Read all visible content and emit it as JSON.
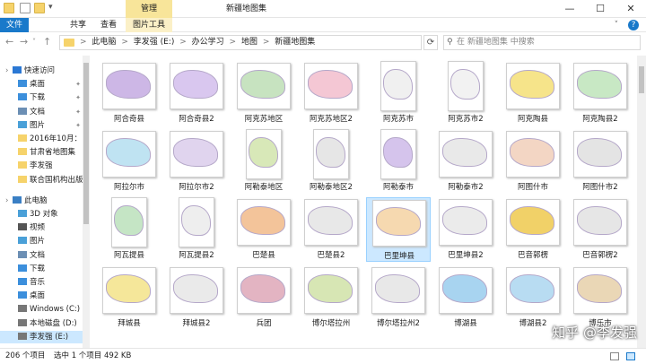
{
  "window": {
    "title": "新疆地图集",
    "context_tab": "管理",
    "controls": {
      "minimize": "—",
      "maximize": "☐",
      "close": "✕"
    }
  },
  "ribbon": {
    "tabs": [
      "文件",
      "共享",
      "查看",
      "图片工具"
    ],
    "chevron": "˅",
    "help": "?"
  },
  "address": {
    "crumbs": [
      "此电脑",
      "李发强 (E:)",
      "办公学习",
      "地图",
      "新疆地图集"
    ],
    "separator": ">",
    "search_placeholder": "在 新疆地图集 中搜索"
  },
  "sidebar": {
    "items": [
      {
        "label": "快速访问",
        "icon": "star-icon",
        "color": "#2b78d4",
        "level": 0,
        "pin": false
      },
      {
        "label": "桌面",
        "icon": "desktop-icon",
        "color": "#3c8fdc",
        "level": 1,
        "pin": true
      },
      {
        "label": "下载",
        "icon": "download-icon",
        "color": "#3c8fdc",
        "level": 1,
        "pin": true
      },
      {
        "label": "文档",
        "icon": "document-icon",
        "color": "#6c8fb4",
        "level": 1,
        "pin": true
      },
      {
        "label": "图片",
        "icon": "picture-icon",
        "color": "#4aa0d8",
        "level": 1,
        "pin": true
      },
      {
        "label": "2016年10月：",
        "icon": "folder-icon",
        "color": "#f6d36b",
        "level": 1,
        "pin": false
      },
      {
        "label": "甘肃省地图集",
        "icon": "folder-icon",
        "color": "#f6d36b",
        "level": 1,
        "pin": false
      },
      {
        "label": "李发强",
        "icon": "folder-icon",
        "color": "#f6d36b",
        "level": 1,
        "pin": false
      },
      {
        "label": "联合国机构出版",
        "icon": "folder-icon",
        "color": "#f6d36b",
        "level": 1,
        "pin": false
      },
      {
        "label": "此电脑",
        "icon": "computer-icon",
        "color": "#3a7fc4",
        "level": 0,
        "pin": false
      },
      {
        "label": "3D 对象",
        "icon": "cube-icon",
        "color": "#4aa0d8",
        "level": 1,
        "pin": false
      },
      {
        "label": "视频",
        "icon": "video-icon",
        "color": "#555",
        "level": 1,
        "pin": false
      },
      {
        "label": "图片",
        "icon": "picture-icon",
        "color": "#4aa0d8",
        "level": 1,
        "pin": false
      },
      {
        "label": "文档",
        "icon": "document-icon",
        "color": "#6c8fb4",
        "level": 1,
        "pin": false
      },
      {
        "label": "下载",
        "icon": "download-icon",
        "color": "#3c8fdc",
        "level": 1,
        "pin": false
      },
      {
        "label": "音乐",
        "icon": "music-icon",
        "color": "#3c8fdc",
        "level": 1,
        "pin": false
      },
      {
        "label": "桌面",
        "icon": "desktop-icon",
        "color": "#3c8fdc",
        "level": 1,
        "pin": false
      },
      {
        "label": "Windows (C:)",
        "icon": "drive-icon",
        "color": "#777",
        "level": 1,
        "pin": false
      },
      {
        "label": "本地磁盘 (D:)",
        "icon": "drive-icon",
        "color": "#777",
        "level": 1,
        "pin": false
      },
      {
        "label": "李发强 (E:)",
        "icon": "drive-icon",
        "color": "#777",
        "level": 1,
        "pin": false,
        "selected": true
      }
    ]
  },
  "files": [
    {
      "name": "阿合奇县",
      "shape": "#cdb7e6",
      "tall": false
    },
    {
      "name": "阿合奇县2",
      "shape": "#d9c7ef",
      "tall": false
    },
    {
      "name": "阿克苏地区",
      "shape": "#c7e3c0",
      "tall": false
    },
    {
      "name": "阿克苏地区2",
      "shape": "#f4c7d4",
      "tall": false
    },
    {
      "name": "阿克苏市",
      "shape": "#f0f0f0",
      "tall": true
    },
    {
      "name": "阿克苏市2",
      "shape": "#f2f2f2",
      "tall": true
    },
    {
      "name": "阿克陶县",
      "shape": "#f6e48a",
      "tall": false
    },
    {
      "name": "阿克陶县2",
      "shape": "#c8e8c4",
      "tall": false
    },
    {
      "name": "阿拉尔市",
      "shape": "#bfe3f2",
      "tall": false
    },
    {
      "name": "阿拉尔市2",
      "shape": "#e0d4ee",
      "tall": false
    },
    {
      "name": "阿勒泰地区",
      "shape": "#d8e8b8",
      "tall": true
    },
    {
      "name": "阿勒泰地区2",
      "shape": "#e6e6e6",
      "tall": true
    },
    {
      "name": "阿勒泰市",
      "shape": "#d5c4ec",
      "tall": true
    },
    {
      "name": "阿勒泰市2",
      "shape": "#e9e9e9",
      "tall": false
    },
    {
      "name": "阿图什市",
      "shape": "#f3d6c4",
      "tall": false
    },
    {
      "name": "阿图什市2",
      "shape": "#e4e4e4",
      "tall": false
    },
    {
      "name": "阿瓦提县",
      "shape": "#c5e5c5",
      "tall": true
    },
    {
      "name": "阿瓦提县2",
      "shape": "#eeeeee",
      "tall": true
    },
    {
      "name": "巴楚县",
      "shape": "#f3c49a",
      "tall": false
    },
    {
      "name": "巴楚县2",
      "shape": "#e8e8e8",
      "tall": false
    },
    {
      "name": "巴里坤县",
      "shape": "#f6d9b0",
      "tall": false,
      "selected": true
    },
    {
      "name": "巴里坤县2",
      "shape": "#ebebeb",
      "tall": false
    },
    {
      "name": "巴音郭楞",
      "shape": "#f1d168",
      "tall": false
    },
    {
      "name": "巴音郭楞2",
      "shape": "#e6e6e6",
      "tall": false
    },
    {
      "name": "拜城县",
      "shape": "#f5e79a",
      "tall": false
    },
    {
      "name": "拜城县2",
      "shape": "#eaeaea",
      "tall": false
    },
    {
      "name": "兵团",
      "shape": "#e3b4c2",
      "tall": false
    },
    {
      "name": "博尔塔拉州",
      "shape": "#d7e6b4",
      "tall": false
    },
    {
      "name": "博尔塔拉州2",
      "shape": "#e8e8e8",
      "tall": false
    },
    {
      "name": "博湖县",
      "shape": "#a8d4f0",
      "tall": false
    },
    {
      "name": "博湖县2",
      "shape": "#b8dcf2",
      "tall": false
    },
    {
      "name": "博乐市",
      "shape": "#ead7b6",
      "tall": false
    }
  ],
  "status": {
    "count": "206 个项目",
    "selection": "选中 1 个项目",
    "size": "492 KB"
  },
  "watermark": "知乎 @李发强"
}
